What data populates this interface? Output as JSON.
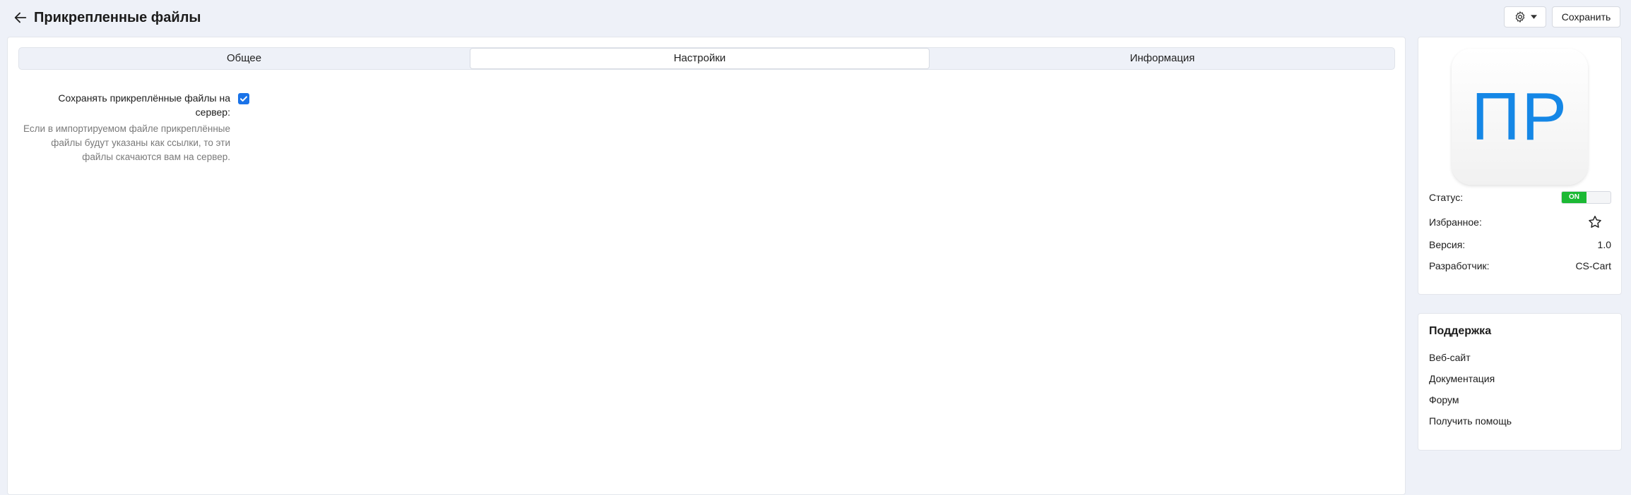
{
  "header": {
    "title": "Прикрепленные файлы",
    "back_icon": "arrow-left-icon",
    "settings_icon": "gear-icon",
    "save_label": "Сохранить"
  },
  "tabs": [
    {
      "label": "Общее",
      "active": false
    },
    {
      "label": "Настройки",
      "active": true
    },
    {
      "label": "Информация",
      "active": false
    }
  ],
  "setting": {
    "label": "Сохранять прикреплённые файлы на сервер:",
    "description": "Если в импортируемом файле прикреплённые файлы будут указаны как ссылки, то эти файлы скачаются вам на сервер.",
    "checked": true
  },
  "addon": {
    "logo_text": "ПР",
    "logo_color": "#1587e6",
    "status_label": "Статус:",
    "status_value": "ON",
    "status_color": "#1bb934",
    "favorite_label": "Избранное:",
    "favorite_icon": "star-icon",
    "version_label": "Версия:",
    "version_value": "1.0",
    "developer_label": "Разработчик:",
    "developer_value": "CS-Cart"
  },
  "support": {
    "title": "Поддержка",
    "links": [
      "Веб-сайт",
      "Документация",
      "Форум",
      "Получить помощь"
    ]
  }
}
